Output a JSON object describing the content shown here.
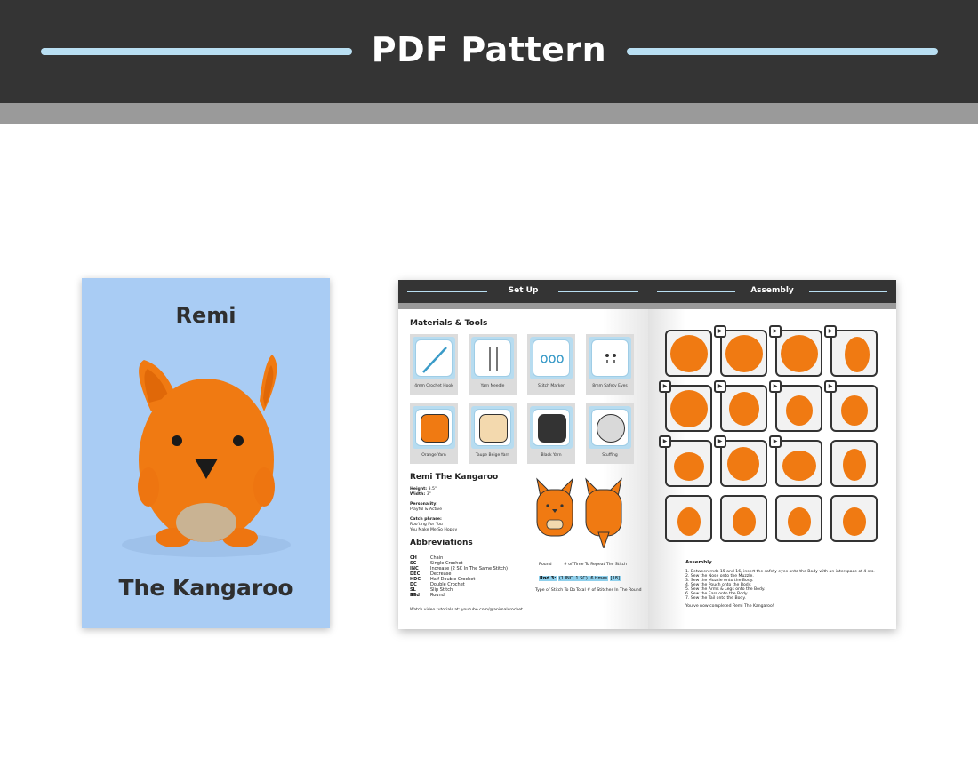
{
  "banner": {
    "title": "PDF Pattern"
  },
  "cover": {
    "title_line1": "Remi",
    "title_line2": "The Kangaroo"
  },
  "left_page": {
    "header": "Set Up",
    "materials_title": "Materials & Tools",
    "tools": [
      {
        "label": "4mm Crochet Hook",
        "icon": "crochet-hook-icon"
      },
      {
        "label": "Yarn Needle",
        "icon": "yarn-needle-icon"
      },
      {
        "label": "Stitch Marker",
        "icon": "stitch-marker-icon"
      },
      {
        "label": "8mm Safety Eyes",
        "icon": "safety-eyes-icon"
      },
      {
        "label": "Orange Yarn",
        "color": "#f07a12"
      },
      {
        "label": "Taupe Beige Yarn",
        "color": "#f3d9ae"
      },
      {
        "label": "Black Yarn",
        "color": "#333333"
      },
      {
        "label": "Stuffing",
        "color": "#d9d9d9"
      }
    ],
    "character_title": "Remi The Kangaroo",
    "height_label": "Height:",
    "height_value": "3.5\"",
    "width_label": "Width:",
    "width_value": "3\"",
    "personality_label": "Personality:",
    "personality_value": "Playful & Active",
    "catch_label": "Catch phrase:",
    "catch_line1": "Roo'ting For You",
    "catch_line2": "You Make Me So Hoppy",
    "abbreviations_title": "Abbreviations",
    "abbreviations": [
      {
        "k": "CH",
        "v": "Chain"
      },
      {
        "k": "SC",
        "v": "Single Crochet"
      },
      {
        "k": "INC",
        "v": "Increase (2 SC In The Same Stitch)"
      },
      {
        "k": "DEC",
        "v": "Decrease"
      },
      {
        "k": "HDC",
        "v": "Half Double Crochet"
      },
      {
        "k": "DC",
        "v": "Double Crochet"
      },
      {
        "k": "SL ST",
        "v": "Slip Stitch"
      },
      {
        "k": "Rnd",
        "v": "Round"
      }
    ],
    "diagram": {
      "round": "Round",
      "repeat": "# of Time To Repeat The Stitch",
      "rnd": "Rnd 3:",
      "stitch": "(1 INC, 1 SC)",
      "times": "6 times",
      "total": "[18]",
      "type": "Type of Stitch To Do",
      "total_label": "Total # of Stitches In The Round"
    },
    "footer": "Watch video tutorials at: youtube.com/@animalcrochet"
  },
  "right_page": {
    "header": "Assembly",
    "assembly_title": "Assembly",
    "steps": [
      "1. Between rnds 15 and 16, insert the safety eyes onto the Body with an interspace of 4 sts.",
      "2. Sew the Nose onto the Muzzle.",
      "3. Sew the Muzzle onto the Body.",
      "4. Sew the Pouch onto the Body.",
      "5. Sew the Arms & Legs onto the Body.",
      "6. Sew the Ears onto the Body.",
      "7. Sew the Tail onto the Body."
    ],
    "closing": "You've now completed Remi The Kangaroo!"
  }
}
